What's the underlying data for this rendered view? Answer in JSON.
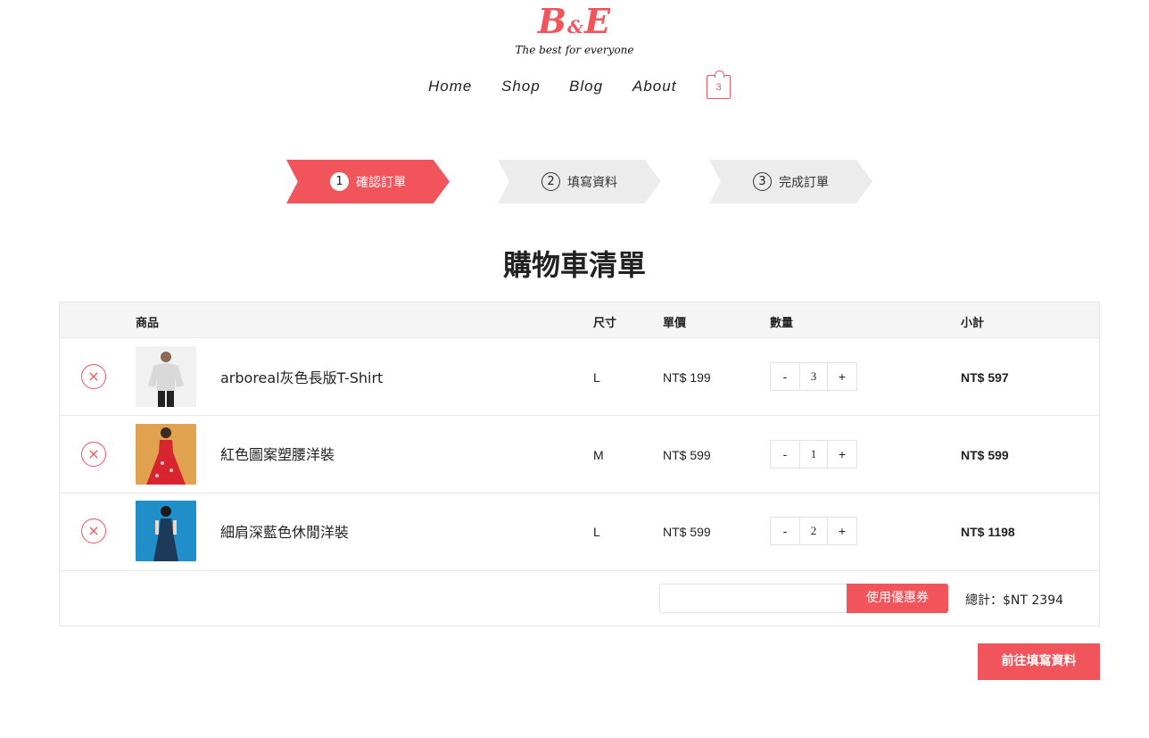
{
  "brand": {
    "logo_left": "B",
    "logo_amp": "&",
    "logo_right": "E",
    "tagline": "The best for everyone",
    "accent_color": "#f2545b"
  },
  "nav": {
    "home": "Home",
    "shop": "Shop",
    "blog": "Blog",
    "about": "About",
    "cart_count": "3"
  },
  "steps": [
    {
      "num": "1",
      "label": "確認訂單",
      "active": true
    },
    {
      "num": "2",
      "label": "填寫資料",
      "active": false
    },
    {
      "num": "3",
      "label": "完成訂單",
      "active": false
    }
  ],
  "page_title": "購物車清單",
  "table": {
    "headers": {
      "product": "商品",
      "size": "尺寸",
      "price": "單價",
      "quantity": "數量",
      "subtotal": "小計"
    },
    "rows": [
      {
        "name": "arboreal灰色長版T-Shirt",
        "size": "L",
        "price": "NT$ 199",
        "qty": "3",
        "subtotal": "NT$ 597"
      },
      {
        "name": "紅色圖案塑腰洋裝",
        "size": "M",
        "price": "NT$ 599",
        "qty": "1",
        "subtotal": "NT$ 599"
      },
      {
        "name": "細肩深藍色休閒洋裝",
        "size": "L",
        "price": "NT$ 599",
        "qty": "2",
        "subtotal": "NT$ 1198"
      }
    ],
    "remove_symbol": "×",
    "minus": "-",
    "plus": "+"
  },
  "coupon": {
    "input_value": "",
    "button_label": "使用優惠券"
  },
  "total_text": "總計：$NT 2394",
  "next_button": "前往填寫資料"
}
